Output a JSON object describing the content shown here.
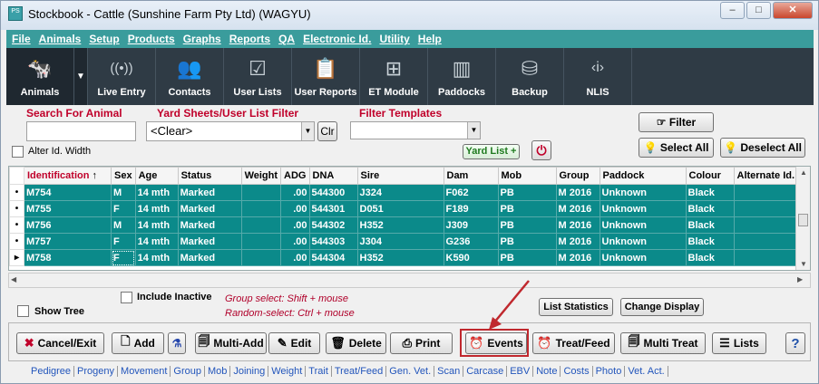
{
  "window": {
    "title": "Stockbook - Cattle (Sunshine Farm Pty Ltd) (WAGYU)",
    "controls": [
      "–",
      "□",
      "✕"
    ]
  },
  "menu": [
    "File",
    "Animals",
    "Setup",
    "Products",
    "Graphs",
    "Reports",
    "QA",
    "Electronic Id.",
    "Utility",
    "Help"
  ],
  "toolbar": {
    "items": [
      {
        "label": "Animals",
        "icon": "cow-icon",
        "glyph": "🐄"
      },
      {
        "label": "Live Entry",
        "icon": "wireless-icon",
        "glyph": "((•))"
      },
      {
        "label": "Contacts",
        "icon": "people-icon",
        "glyph": "👥"
      },
      {
        "label": "User Lists",
        "icon": "checklist-icon",
        "glyph": "☑"
      },
      {
        "label": "User Reports",
        "icon": "report-icon",
        "glyph": "📋"
      },
      {
        "label": "ET Module",
        "icon": "hierarchy-icon",
        "glyph": "⊞"
      },
      {
        "label": "Paddocks",
        "icon": "fence-icon",
        "glyph": "▥"
      },
      {
        "label": "Backup",
        "icon": "database-icon",
        "glyph": "⛁"
      },
      {
        "label": "NLIS",
        "icon": "nlis-icon",
        "glyph": "‹i›"
      }
    ],
    "dropdown_arrow": "❯"
  },
  "filters": {
    "search_label": "Search For Animal",
    "search_value": "",
    "yard_label": "Yard Sheets/User List Filter",
    "yard_value": "<Clear>",
    "clr_label": "Clr",
    "templates_label": "Filter Templates",
    "templates_value": "",
    "yard_list_label": "Yard List +",
    "alter_id_label": "Alter Id. Width",
    "filter_label": "Filter",
    "select_all_label": "Select All",
    "deselect_all_label": "Deselect All"
  },
  "grid": {
    "columns": [
      "Identification",
      "Sex",
      "Age",
      "Status",
      "Weight",
      "ADG",
      "DNA",
      "Sire",
      "Dam",
      "Mob",
      "Group",
      "Paddock",
      "Colour",
      "Alternate Id."
    ],
    "sort_indicator": "↑",
    "rows": [
      {
        "marker": "•",
        "cells": [
          "M754",
          "M",
          "14 mth",
          "Marked",
          "",
          ".00",
          "544300",
          "J324",
          "F062",
          "PB",
          "M 2016",
          "Unknown",
          "Black",
          ""
        ]
      },
      {
        "marker": "•",
        "cells": [
          "M755",
          "F",
          "14 mth",
          "Marked",
          "",
          ".00",
          "544301",
          "D051",
          "F189",
          "PB",
          "M 2016",
          "Unknown",
          "Black",
          ""
        ]
      },
      {
        "marker": "•",
        "cells": [
          "M756",
          "M",
          "14 mth",
          "Marked",
          "",
          ".00",
          "544302",
          "H352",
          "J309",
          "PB",
          "M 2016",
          "Unknown",
          "Black",
          ""
        ]
      },
      {
        "marker": "•",
        "cells": [
          "M757",
          "F",
          "14 mth",
          "Marked",
          "",
          ".00",
          "544303",
          "J304",
          "G236",
          "PB",
          "M 2016",
          "Unknown",
          "Black",
          ""
        ]
      },
      {
        "marker": "▸",
        "cells": [
          "M758",
          "F",
          "14 mth",
          "Marked",
          "",
          ".00",
          "544304",
          "H352",
          "K590",
          "PB",
          "M 2016",
          "Unknown",
          "Black",
          ""
        ]
      }
    ]
  },
  "options": {
    "include_inactive_label": "Include Inactive",
    "show_tree_label": "Show Tree",
    "group_select_note": "Group select: Shift + mouse",
    "random_select_note": "Random-select: Ctrl + mouse",
    "list_statistics_label": "List Statistics",
    "change_display_label": "Change Display"
  },
  "actions": {
    "cancel_exit": "Cancel/Exit",
    "add": "Add",
    "multi_add": "Multi-Add",
    "edit": "Edit",
    "delete": "Delete",
    "print": "Print",
    "events": "Events",
    "treat_feed": "Treat/Feed",
    "multi_treat": "Multi Treat",
    "lists": "Lists",
    "help": "?"
  },
  "links": [
    "Pedigree",
    "Progeny",
    "Movement",
    "Group",
    "Mob",
    "Joining",
    "Weight",
    "Trait",
    "Treat/Feed",
    "Gen. Vet.",
    "Scan",
    "Carcase",
    "EBV",
    "Note",
    "Costs",
    "Photo",
    "Vet. Act."
  ],
  "colors": {
    "accent": "#3a9c9c",
    "toolbar": "#2f3b45",
    "row_selected": "#0b8a8a",
    "label_red": "#c0002a",
    "highlight": "#c0282e"
  }
}
